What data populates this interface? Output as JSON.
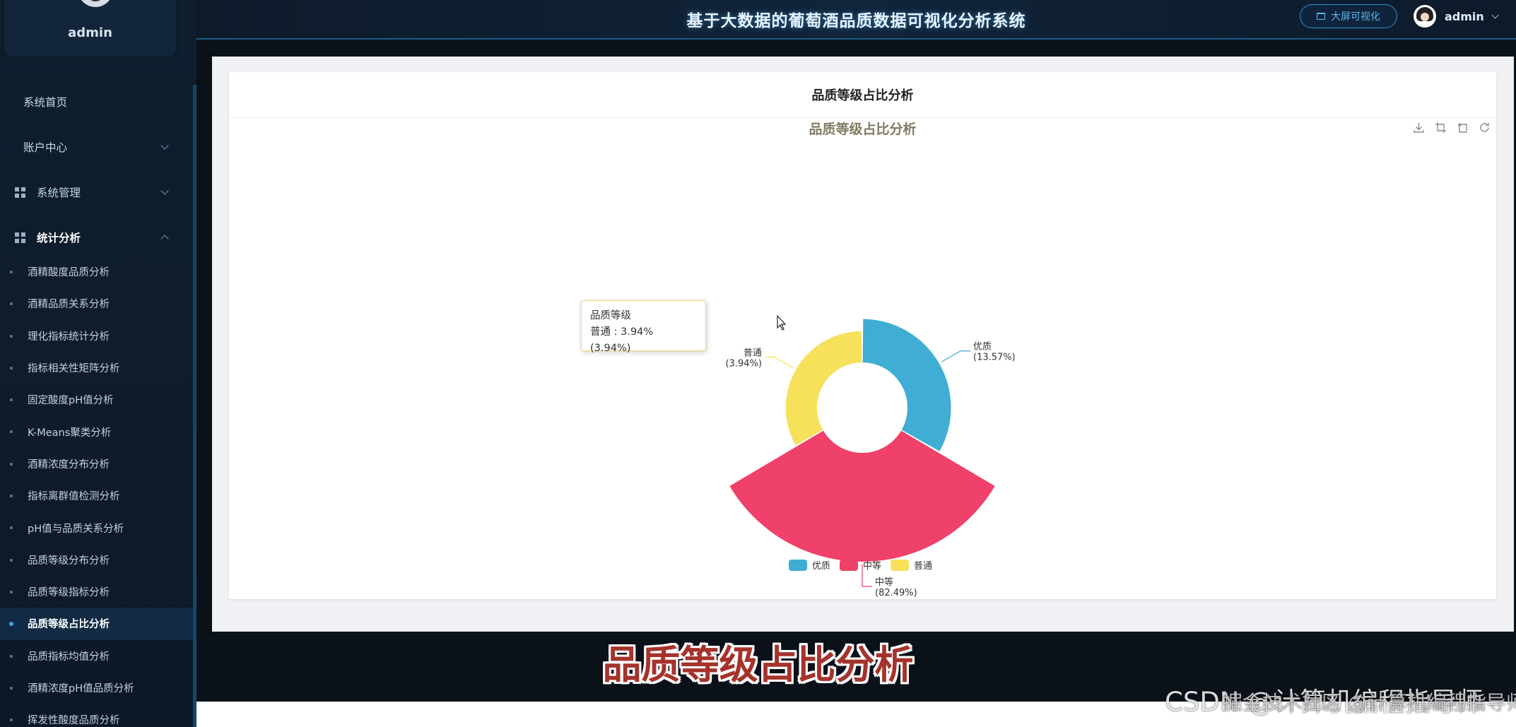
{
  "app": {
    "title": "基于大数据的葡萄酒品质数据可视化分析系统",
    "big_screen_label": "大屏可视化",
    "user_name": "admin"
  },
  "sidebar": {
    "profile_name": "admin",
    "menu": [
      {
        "label": "系统首页"
      },
      {
        "label": "账户中心"
      },
      {
        "label": "系统管理"
      },
      {
        "label": "统计分析"
      }
    ],
    "submenu": [
      "酒精酸度品质分析",
      "酒精品质关系分析",
      "理化指标统计分析",
      "指标相关性矩阵分析",
      "固定酸度pH值分析",
      "K-Means聚类分析",
      "酒精浓度分布分析",
      "指标离群值检测分析",
      "pH值与品质关系分析",
      "品质等级分布分析",
      "品质等级指标分析",
      "品质等级占比分析",
      "品质指标均值分析",
      "酒精浓度pH值品质分析",
      "挥发性酸度品质分析"
    ],
    "active_submenu": "品质等级占比分析"
  },
  "card": {
    "header": "品质等级占比分析"
  },
  "chart_data": {
    "type": "pie",
    "subtype": "nightingale-rose",
    "title": "品质等级占比分析",
    "series_name": "品质等级",
    "slices": [
      {
        "name": "优质",
        "value": 13.57,
        "label": "(13.57%)",
        "color": "#3fadd4"
      },
      {
        "name": "中等",
        "value": 82.49,
        "label": "(82.49%)",
        "color": "#ef4169"
      },
      {
        "name": "普通",
        "value": 3.94,
        "label": "(3.94%)",
        "color": "#f7e05a"
      }
    ],
    "legend": [
      "优质",
      "中等",
      "普通"
    ],
    "legend_position": "bottom-center"
  },
  "tooltip": {
    "title": "品质等级",
    "text": "普通 : 3.94% (3.94%)"
  },
  "overlay_caption": "品质等级占比分析",
  "watermark": {
    "line1": "CSDN @计算机编程指导师",
    "line2": "掘金技术社区 @计算机编程指导师"
  },
  "icons": [
    "download-icon",
    "zoom-icon",
    "zoom-reset-icon",
    "restore-icon",
    "cart-icon",
    "chevron-down-icon",
    "grid-icon"
  ]
}
